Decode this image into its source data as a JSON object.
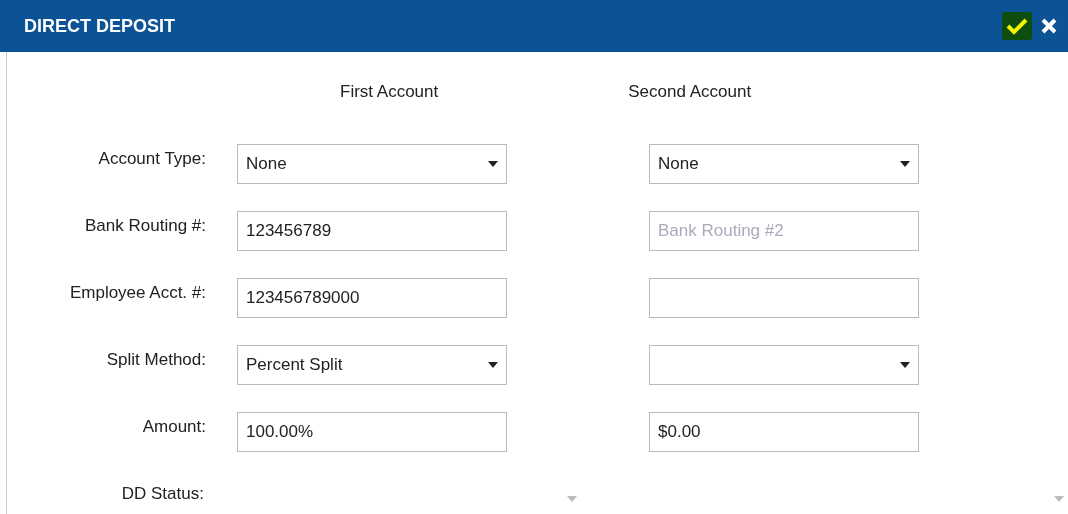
{
  "dialog": {
    "title": "DIRECT DEPOSIT",
    "actions": [
      {
        "kind": "confirm"
      },
      {
        "kind": "close"
      }
    ]
  },
  "columns": [
    "First Account",
    "Second Account"
  ],
  "rows": [
    {
      "label": "Account Type:",
      "fields": [
        {
          "kind": "select",
          "value": "None"
        },
        {
          "kind": "select",
          "value": "None"
        }
      ]
    },
    {
      "label": "Bank Routing #:",
      "fields": [
        {
          "kind": "input",
          "value": "123456789"
        },
        {
          "kind": "input",
          "placeholder": "Bank Routing #2"
        }
      ]
    },
    {
      "label": "Employee Acct. #:",
      "fields": [
        {
          "kind": "input",
          "value": "123456789000"
        },
        {
          "kind": "input"
        }
      ]
    },
    {
      "label": "Split Method:",
      "fields": [
        {
          "kind": "select",
          "value": "Percent Split"
        },
        {
          "kind": "select"
        }
      ]
    },
    {
      "label": "Amount:",
      "fields": [
        {
          "kind": "input",
          "value": "100.00%"
        },
        {
          "kind": "input",
          "value": "$0.00"
        }
      ]
    },
    {
      "label": "DD Status:",
      "fields": [
        {
          "kind": "bare-select"
        },
        {
          "kind": "bare-select"
        }
      ]
    }
  ]
}
